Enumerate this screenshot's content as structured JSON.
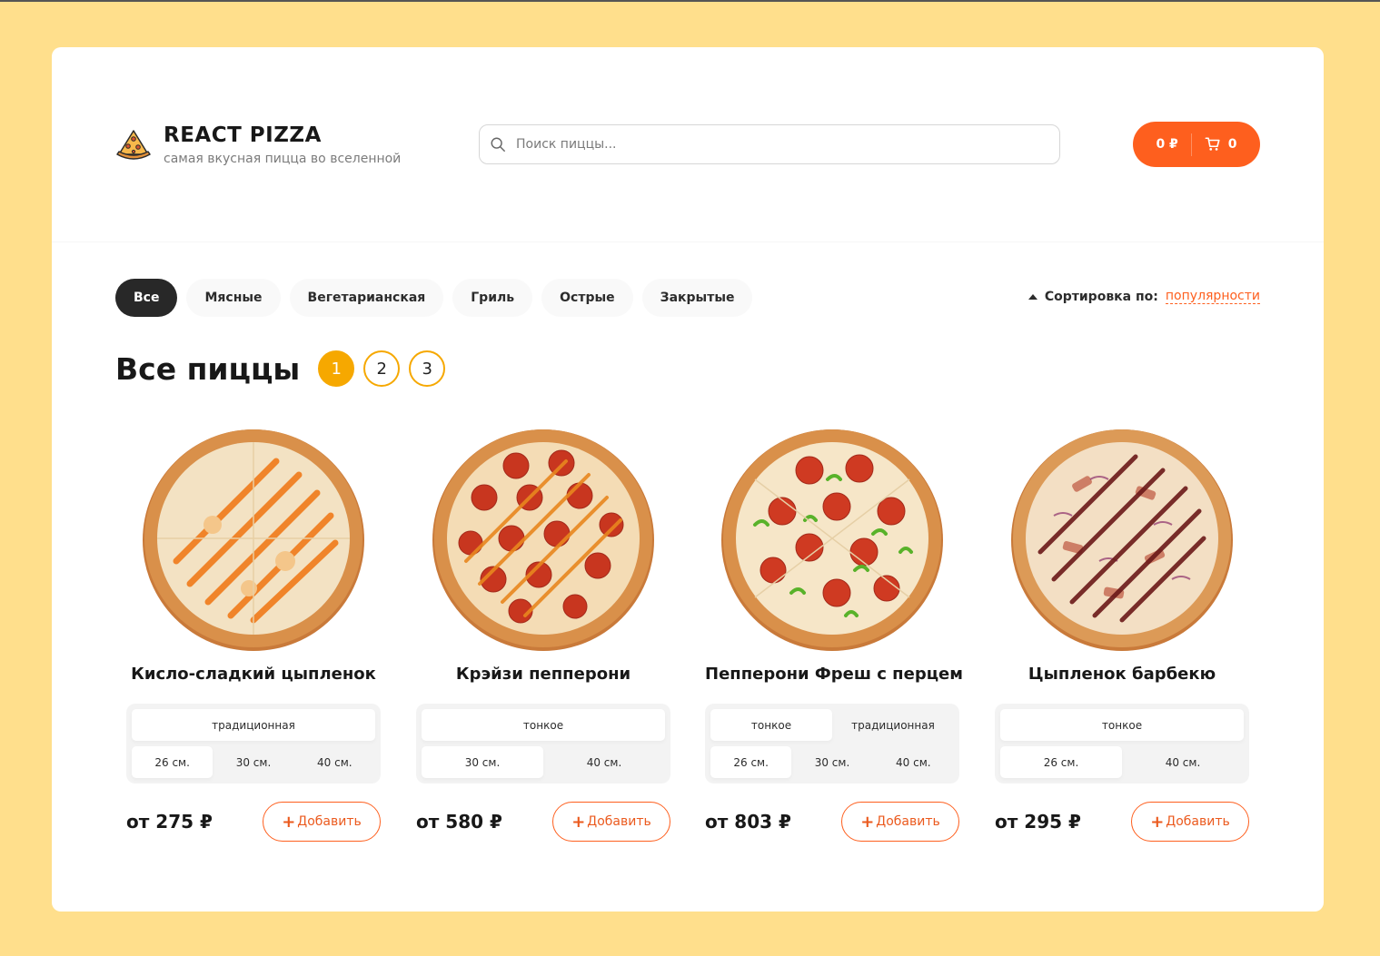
{
  "header": {
    "title": "REACT PIZZA",
    "subtitle": "самая вкусная пицца во вселенной",
    "search_placeholder": "Поиск пиццы...",
    "cart_total": "0 ₽",
    "cart_count": "0"
  },
  "categories": [
    "Все",
    "Мясные",
    "Вегетарианская",
    "Гриль",
    "Острые",
    "Закрытые"
  ],
  "active_category": "Все",
  "sort": {
    "label": "Сортировка по:",
    "value": "популярности"
  },
  "page_title": "Все пиццы",
  "pagination": [
    "1",
    "2",
    "3"
  ],
  "active_page": "1",
  "add_label": "Добавить",
  "colors": {
    "accent": "#fe5f1e",
    "page_active": "#f6a800",
    "background": "#ffdf8c"
  },
  "pizzas": [
    {
      "name": "Кисло-сладкий цыпленок",
      "types": [
        "традиционная"
      ],
      "sizes": [
        "26 см.",
        "30 см.",
        "40 см."
      ],
      "price": "от 275 ₽",
      "sauce": "#ef7a1a"
    },
    {
      "name": "Крэйзи пепперони",
      "types": [
        "тонкое"
      ],
      "sizes": [
        "30 см.",
        "40 см."
      ],
      "price": "от 580 ₽",
      "sauce": "#e8861e"
    },
    {
      "name": "Пепперони Фреш с перцем",
      "types": [
        "тонкое",
        "традиционная"
      ],
      "sizes": [
        "26 см.",
        "30 см.",
        "40 см."
      ],
      "price": "от 803 ₽",
      "sauce": "#59b22a"
    },
    {
      "name": "Цыпленок барбекю",
      "types": [
        "тонкое"
      ],
      "sizes": [
        "26 см.",
        "40 см."
      ],
      "price": "от 295 ₽",
      "sauce": "#6a1818"
    }
  ]
}
